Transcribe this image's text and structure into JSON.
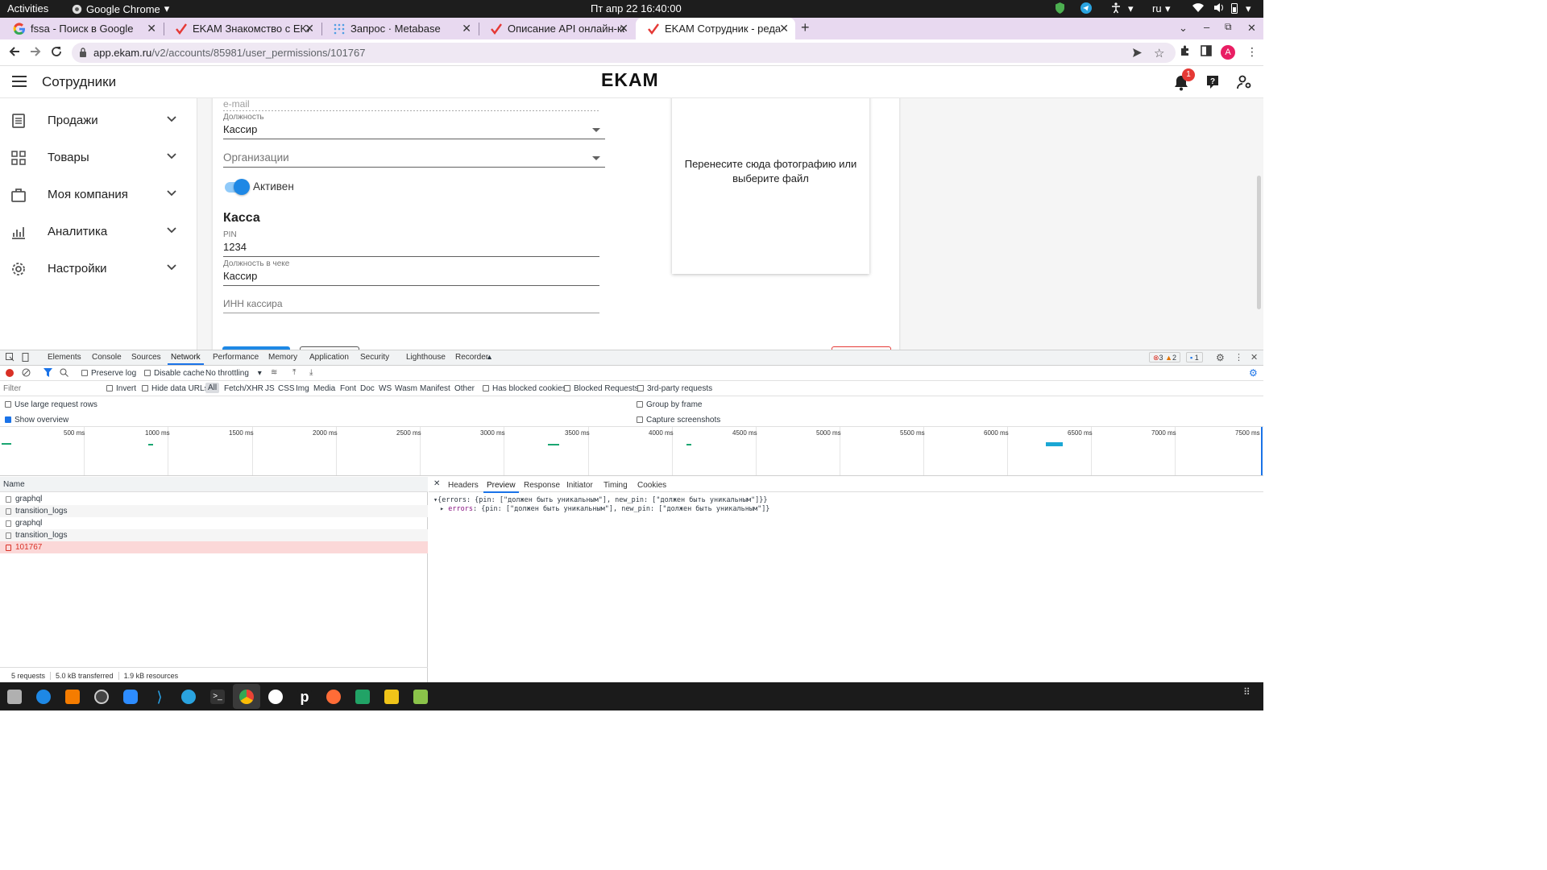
{
  "system_bar": {
    "activities": "Activities",
    "app_name": "Google Chrome",
    "clock": "Пт апр 22  16:40:00",
    "keyboard_layout": "ru"
  },
  "browser": {
    "tabs": [
      {
        "title": "fssa - Поиск в Google",
        "icon": "google-g-icon"
      },
      {
        "title": "EKAM Знакомство с EKAM",
        "icon": "ekam-check-icon"
      },
      {
        "title": "Запрос · Metabase",
        "icon": "metabase-icon"
      },
      {
        "title": "Описание API онлайн-касс",
        "icon": "ekam-check-icon"
      },
      {
        "title": "EKAM Сотрудник - редакт",
        "icon": "ekam-check-icon",
        "active": true
      }
    ],
    "url_host": "app.ekam.ru",
    "url_path": "/v2/accounts/85981/user_permissions/101767",
    "profile_initial": "A"
  },
  "app": {
    "page_title": "Сотрудники",
    "logo": "EKAM",
    "notifications_count": "1",
    "sidebar": [
      {
        "label": "Продажи",
        "icon": "list-icon"
      },
      {
        "label": "Товары",
        "icon": "grid-icon"
      },
      {
        "label": "Моя компания",
        "icon": "briefcase-icon"
      },
      {
        "label": "Аналитика",
        "icon": "chart-icon"
      },
      {
        "label": "Настройки",
        "icon": "gear-icon"
      }
    ],
    "form": {
      "email_placeholder": "e-mail",
      "position_label": "Должность",
      "position_value": "Кассир",
      "organizations_placeholder": "Организации",
      "active_label": "Активен",
      "active": true,
      "cash_section_title": "Касса",
      "pin_label": "PIN",
      "pin_value": "1234",
      "receipt_position_label": "Должность в чеке",
      "receipt_position_value": "Кассир",
      "inn_placeholder": "ИНН кассира"
    },
    "photo_drop_text_1": "Перенесите сюда фотографию или",
    "photo_drop_text_2": "выберите файл"
  },
  "devtools": {
    "tabs": [
      "Elements",
      "Console",
      "Sources",
      "Network",
      "Performance",
      "Memory",
      "Application",
      "Security",
      "Lighthouse",
      "Recorder"
    ],
    "active_tab": "Network",
    "errors": "3",
    "warnings": "2",
    "messages": "1",
    "toolbar": {
      "preserve_log": "Preserve log",
      "disable_cache": "Disable cache",
      "throttling": "No throttling"
    },
    "filter": {
      "placeholder": "Filter",
      "invert": "Invert",
      "hide_data_urls": "Hide data URLs",
      "types": [
        "All",
        "Fetch/XHR",
        "JS",
        "CSS",
        "Img",
        "Media",
        "Font",
        "Doc",
        "WS",
        "Wasm",
        "Manifest",
        "Other"
      ],
      "has_blocked_cookies": "Has blocked cookies",
      "blocked_requests": "Blocked Requests",
      "third_party": "3rd-party requests"
    },
    "options": {
      "large_rows": "Use large request rows",
      "show_overview": "Show overview",
      "group_by_frame": "Group by frame",
      "capture_screenshots": "Capture screenshots"
    },
    "timeline_ticks": [
      "500 ms",
      "1000 ms",
      "1500 ms",
      "2000 ms",
      "2500 ms",
      "3000 ms",
      "3500 ms",
      "4000 ms",
      "4500 ms",
      "5000 ms",
      "5500 ms",
      "6000 ms",
      "6500 ms",
      "7000 ms",
      "7500 ms"
    ],
    "name_header": "Name",
    "requests": [
      {
        "name": "graphql",
        "error": false
      },
      {
        "name": "transition_logs",
        "error": false
      },
      {
        "name": "graphql",
        "error": false
      },
      {
        "name": "transition_logs",
        "error": false
      },
      {
        "name": "101767",
        "error": true
      }
    ],
    "footer": {
      "requests": "5 requests",
      "transferred": "5.0 kB transferred",
      "resources": "1.9 kB resources"
    },
    "detail_tabs": [
      "Headers",
      "Preview",
      "Response",
      "Initiator",
      "Timing",
      "Cookies"
    ],
    "active_detail_tab": "Preview",
    "preview_line_1": "{errors: {pin: [\"должен быть уникальным\"], new_pin: [\"должен быть уникальным\"]}}",
    "preview_line_2_key": "errors",
    "preview_line_2_val": ": {pin: [\"должен быть уникальным\"], new_pin: [\"должен быть уникальным\"]}"
  },
  "colors": {
    "accent": "#1a73e8",
    "error": "#d93025",
    "tabstrip": "#e8d9f0",
    "toggle": "#1e88e5"
  }
}
